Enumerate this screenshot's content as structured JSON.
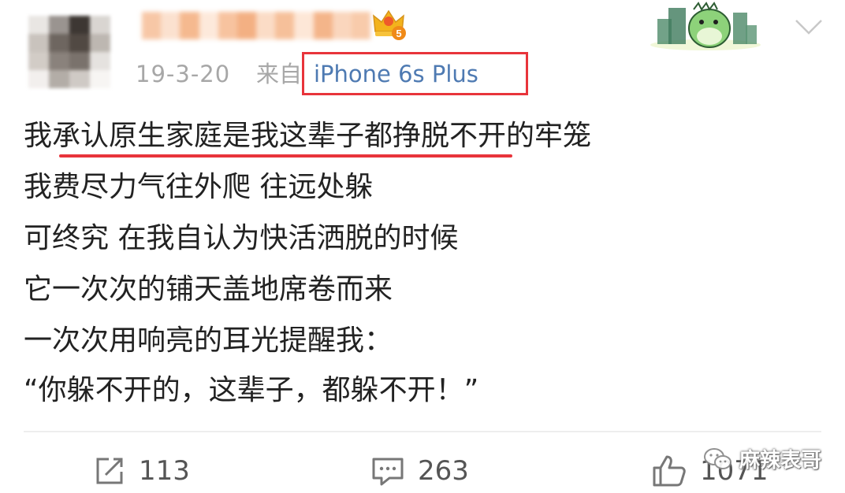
{
  "post": {
    "date": "19-3-20",
    "source_prefix": "来自",
    "device": "iPhone 6s Plus",
    "lines": [
      "我承认原生家庭是我这辈子都挣脱不开的牢笼",
      "我费尽力气往外爬 往远处躲",
      "可终究 在我自认为快活洒脱的时候",
      "它一次次的铺天盖地席卷而来",
      "一次次用响亮的耳光提醒我：",
      "“你躲不开的，这辈子，都躲不开！”"
    ]
  },
  "actions": {
    "share_count": "113",
    "comment_count": "263",
    "like_count": "1071"
  },
  "badge": {
    "vip_level": "5"
  },
  "watermark": {
    "text": "麻辣表哥"
  },
  "icons": {
    "share": "share-icon",
    "comment": "comment-icon",
    "like": "thumbs-up-icon",
    "more": "chevron-down-icon",
    "vip": "crown-icon",
    "watermark": "wechat-icon"
  },
  "colors": {
    "device_link": "#4e7ab2",
    "highlight": "#e8343b",
    "meta": "#a7a7a7",
    "text": "#222222"
  }
}
